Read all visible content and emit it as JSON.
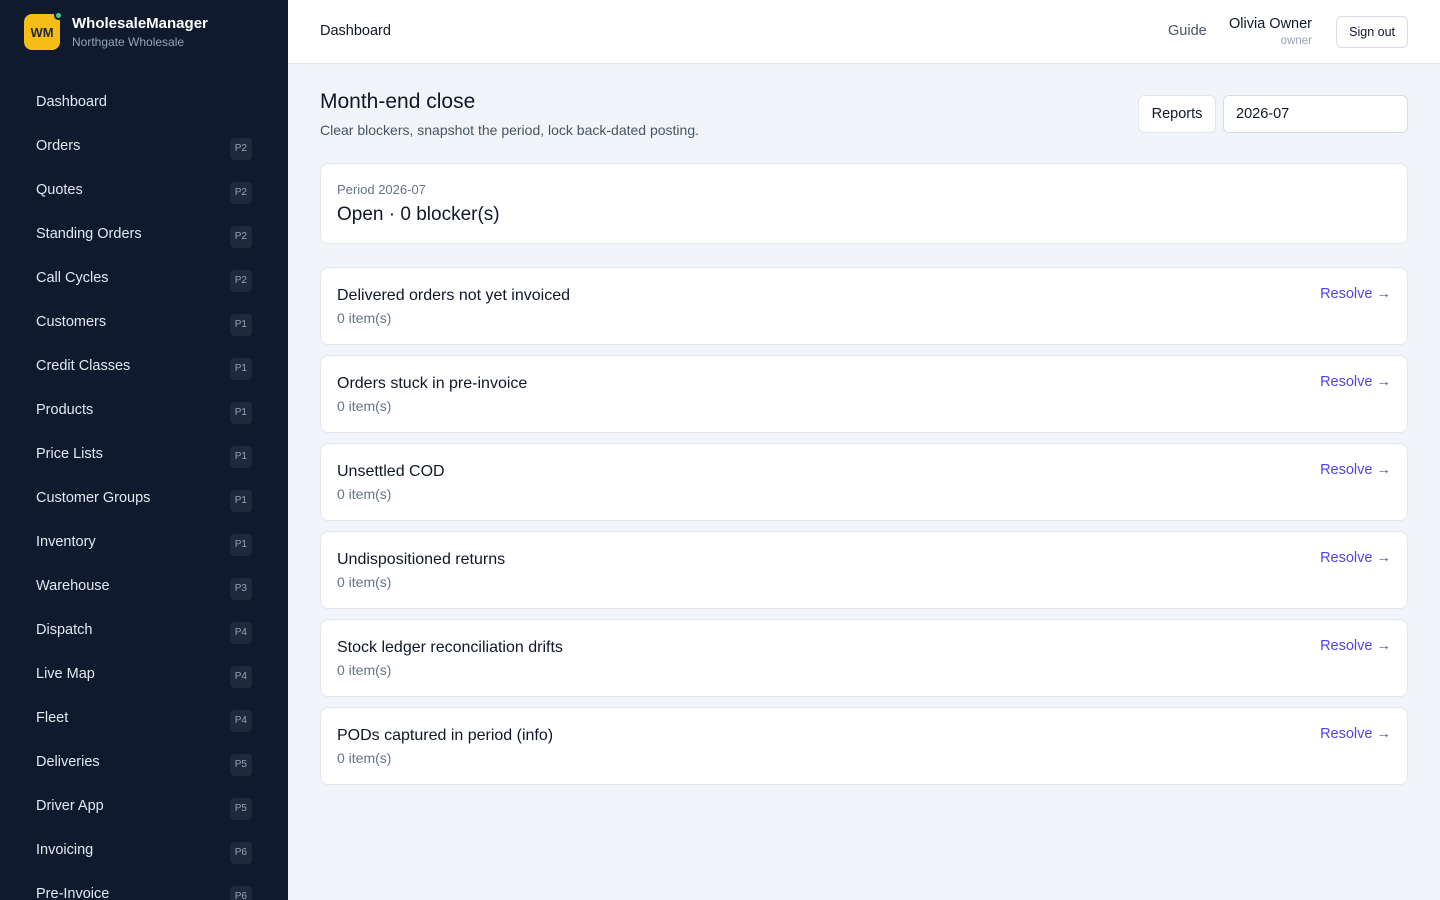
{
  "brand": {
    "logo": "WM",
    "name": "WholesaleManager",
    "org": "Northgate Wholesale"
  },
  "sidebar": {
    "items": [
      {
        "label": "Dashboard",
        "badge": ""
      },
      {
        "label": "Orders",
        "badge": "P2"
      },
      {
        "label": "Quotes",
        "badge": "P2"
      },
      {
        "label": "Standing Orders",
        "badge": "P2"
      },
      {
        "label": "Call Cycles",
        "badge": "P2"
      },
      {
        "label": "Customers",
        "badge": "P1"
      },
      {
        "label": "Credit Classes",
        "badge": "P1"
      },
      {
        "label": "Products",
        "badge": "P1"
      },
      {
        "label": "Price Lists",
        "badge": "P1"
      },
      {
        "label": "Customer Groups",
        "badge": "P1"
      },
      {
        "label": "Inventory",
        "badge": "P1"
      },
      {
        "label": "Warehouse",
        "badge": "P3"
      },
      {
        "label": "Dispatch",
        "badge": "P4"
      },
      {
        "label": "Live Map",
        "badge": "P4"
      },
      {
        "label": "Fleet",
        "badge": "P4"
      },
      {
        "label": "Deliveries",
        "badge": "P5"
      },
      {
        "label": "Driver App",
        "badge": "P5"
      },
      {
        "label": "Invoicing",
        "badge": "P6"
      },
      {
        "label": "Pre-Invoice",
        "badge": "P6"
      }
    ]
  },
  "topbar": {
    "breadcrumb": "Dashboard",
    "guide": "Guide",
    "user_name": "Olivia Owner",
    "user_role": "owner",
    "signout": "Sign out"
  },
  "page": {
    "title": "Month-end close",
    "subtitle": "Clear blockers, snapshot the period, lock back-dated posting.",
    "reports_label": "Reports",
    "period_value": "2026-07"
  },
  "period_card": {
    "label": "Period 2026-07",
    "status": "Open · 0 blocker(s)"
  },
  "blockers": [
    {
      "title": "Delivered orders not yet invoiced",
      "count": "0 item(s)",
      "action": "Resolve →"
    },
    {
      "title": "Orders stuck in pre-invoice",
      "count": "0 item(s)",
      "action": "Resolve →"
    },
    {
      "title": "Unsettled COD",
      "count": "0 item(s)",
      "action": "Resolve →"
    },
    {
      "title": "Undispositioned returns",
      "count": "0 item(s)",
      "action": "Resolve →"
    },
    {
      "title": "Stock ledger reconciliation drifts",
      "count": "0 item(s)",
      "action": "Resolve →"
    },
    {
      "title": "PODs captured in period (info)",
      "count": "0 item(s)",
      "action": "Resolve →"
    }
  ],
  "colors": {
    "sidebar_bg": "#0f1a2e",
    "logo_bg": "#f6bd16",
    "status_dot": "#34d399",
    "link": "#4f46e5"
  }
}
